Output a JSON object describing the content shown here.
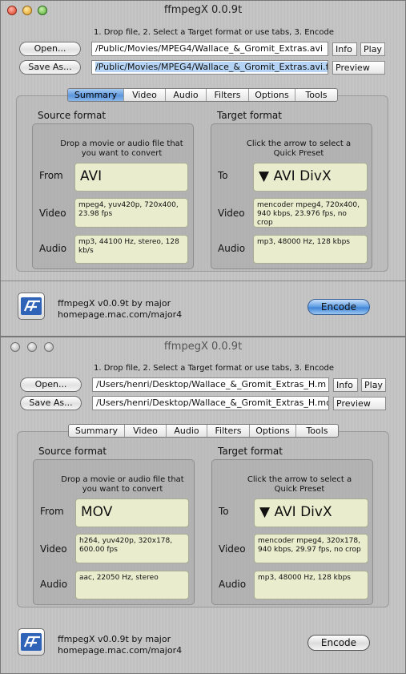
{
  "windows": [
    {
      "title": "ffmpegX 0.0.9t",
      "instructions": "1. Drop file, 2. Select a Target format or use tabs, 3. Encode",
      "open_label": "Open...",
      "save_label": "Save As...",
      "source_path": "/Public/Movies/MPEG4/Wallace_&_Gromit_Extras.avi",
      "dest_path": "/Public/Movies/MPEG4/Wallace_&_Gromit_Extras.avi.f",
      "info_label": "Info",
      "play_label": "Play",
      "preview_label": "Preview",
      "tabs": [
        "Summary",
        "Video",
        "Audio",
        "Filters",
        "Options",
        "Tools"
      ],
      "active_tab": "Summary",
      "source": {
        "header": "Source format",
        "drop_hint": "Drop a movie or audio file that you want to convert",
        "from_label": "From",
        "format": "AVI",
        "video_label": "Video",
        "video": "mpeg4, yuv420p, 720x400, 23.98 fps",
        "audio_label": "Audio",
        "audio": "mp3, 44100 Hz, stereo, 128 kb/s"
      },
      "target": {
        "header": "Target format",
        "hint": "Click the arrow to select a Quick Preset",
        "to_label": "To",
        "format": "▼ AVI DivX",
        "video_label": "Video",
        "video": "mencoder mpeg4, 720x400, 940 kbps, 23.976 fps, no crop",
        "audio_label": "Audio",
        "audio": "mp3, 48000 Hz, 128 kbps"
      },
      "credits_line1": "ffmpegX v0.0.9t by major",
      "credits_line2": "homepage.mac.com/major4",
      "encode_label": "Encode",
      "encode_default": true
    },
    {
      "title": "ffmpegX 0.0.9t",
      "instructions": "1. Drop file, 2. Select a Target format or use tabs, 3. Encode",
      "open_label": "Open...",
      "save_label": "Save As...",
      "source_path": "/Users/henri/Desktop/Wallace_&_Gromit_Extras_H.m",
      "dest_path": "/Users/henri/Desktop/Wallace_&_Gromit_Extras_H.mo",
      "info_label": "Info",
      "play_label": "Play",
      "preview_label": "Preview",
      "tabs": [
        "Summary",
        "Video",
        "Audio",
        "Filters",
        "Options",
        "Tools"
      ],
      "active_tab": "",
      "source": {
        "header": "Source format",
        "drop_hint": "Drop a movie or audio file that you want to convert",
        "from_label": "From",
        "format": "MOV",
        "video_label": "Video",
        "video": "h264, yuv420p, 320x178, 600.00 fps",
        "audio_label": "Audio",
        "audio": "aac, 22050 Hz, stereo"
      },
      "target": {
        "header": "Target format",
        "hint": "Click the arrow to select a Quick Preset",
        "to_label": "To",
        "format": "▼ AVI DivX",
        "video_label": "Video",
        "video": "mencoder mpeg4, 320x178, 940 kbps, 29.97 fps, no crop",
        "audio_label": "Audio",
        "audio": "mp3, 48000 Hz, 128 kbps"
      },
      "credits_line1": "ffmpegX v0.0.9t by major",
      "credits_line2": "homepage.mac.com/major4",
      "encode_label": "Encode",
      "encode_default": false
    }
  ]
}
